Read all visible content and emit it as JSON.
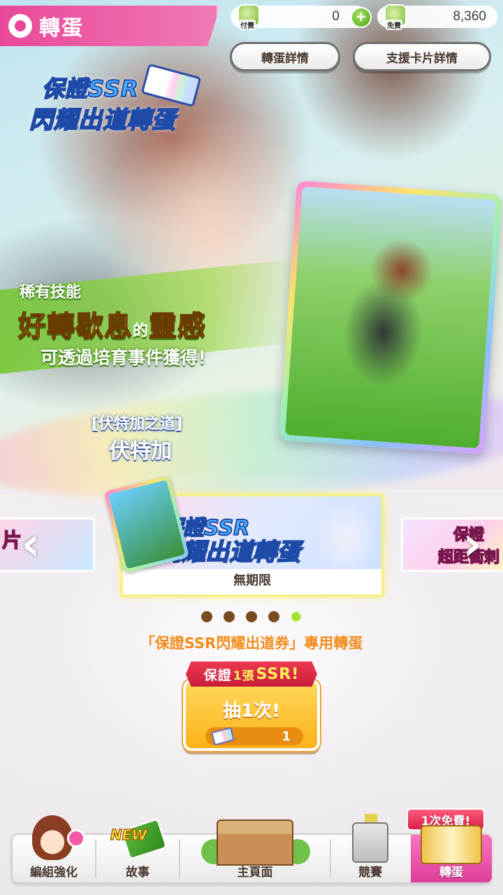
{
  "header": {
    "title": "轉蛋",
    "paid_label": "付費",
    "paid_value": "0",
    "free_label": "免費",
    "free_value": "8,360",
    "gacha_details_label": "轉蛋詳情",
    "support_card_details_label": "支援卡片詳情"
  },
  "banner": {
    "logo_line1": "保證SSR",
    "logo_line2": "閃耀出道轉蛋",
    "skill_subtitle": "稀有技能",
    "skill_name_a": "好轉歇息",
    "skill_name_of": "的",
    "skill_name_b": "靈感",
    "skill_note": "可透過培育事件獲得！",
    "character_subtitle": "[伏特加之道]",
    "character_name": "伏特加"
  },
  "carousel": {
    "left_banner_text": "片",
    "right_banner_text": "保證",
    "right_banner_text2": "超距衝刺",
    "main_logo_line1": "保證SSR",
    "main_logo_line2": "閃耀出道轉蛋",
    "main_period": "無期限",
    "dots_total": 5,
    "active_dot_index": 4
  },
  "ticket_caption": "「保證SSR閃耀出道券」專用轉蛋",
  "pull": {
    "ribbon_prefix": "保證",
    "ribbon_count": "1張",
    "ribbon_suffix": "SSR!",
    "label": "抽1次!",
    "cost": "1"
  },
  "nav": {
    "free_badge": "1次免費!",
    "new_badge": "NEW",
    "items": [
      {
        "label": "編組強化"
      },
      {
        "label": "故事"
      },
      {
        "label": "主頁面"
      },
      {
        "label": "競賽"
      },
      {
        "label": "轉蛋"
      }
    ]
  },
  "colors": {
    "accent_pink": "#e9489a",
    "caption_orange": "#f18d1e",
    "button_yellow": "#ffb21a",
    "active_dot": "#9ee22f"
  }
}
